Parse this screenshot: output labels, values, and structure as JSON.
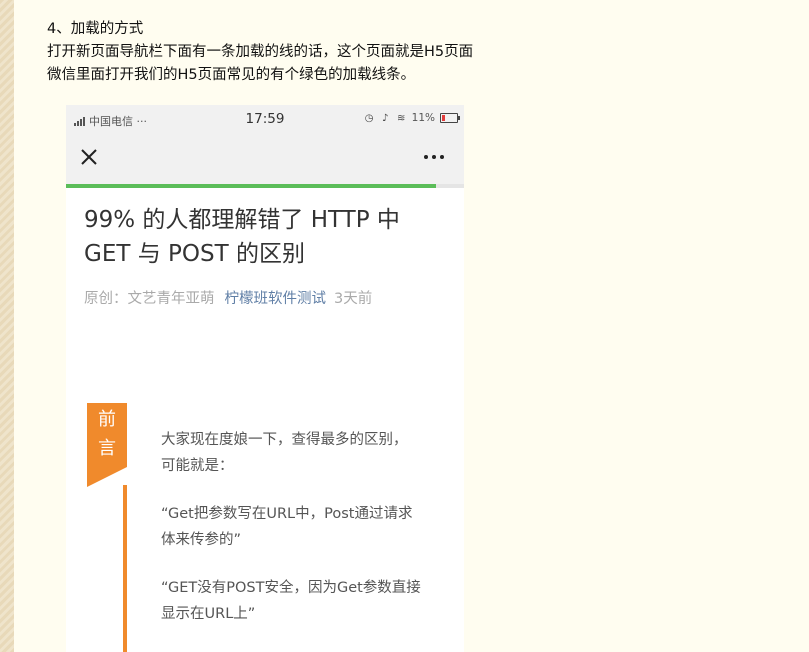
{
  "article": {
    "heading": "4、加载的方式",
    "line1": "打开新页面导航栏下面有一条加载的线的话，这个页面就是H5页面",
    "line2": "微信里面打开我们的H5页面常见的有个绿色的加载线条。"
  },
  "screenshot": {
    "status_bar": {
      "carrier": "中国电信 ···",
      "time": "17:59",
      "battery": "11%",
      "icons": [
        "signal-icon",
        "alarm-icon",
        "bell-icon",
        "wifi-icon",
        "battery-icon"
      ]
    },
    "nav": {
      "close_icon": "close-icon",
      "more_icon": "more-icon"
    },
    "loading_progress": 0.93,
    "loading_color": "#5bbd59",
    "post": {
      "title": "99% 的人都理解错了 HTTP 中 GET 与 POST 的区别",
      "meta_origin": "原创：文艺青年亚萌",
      "meta_account": "柠檬班软件测试",
      "meta_time": "3天前",
      "preface_line1": "前",
      "preface_line2": "言",
      "accent_color": "#f08a2c",
      "paragraphs": [
        "大家现在度娘一下，查得最多的区别，可能就是：",
        "“Get把参数写在URL中，Post通过请求体来传参的”",
        "“GET没有POST安全，因为Get参数直接显示在URL上”"
      ]
    }
  }
}
